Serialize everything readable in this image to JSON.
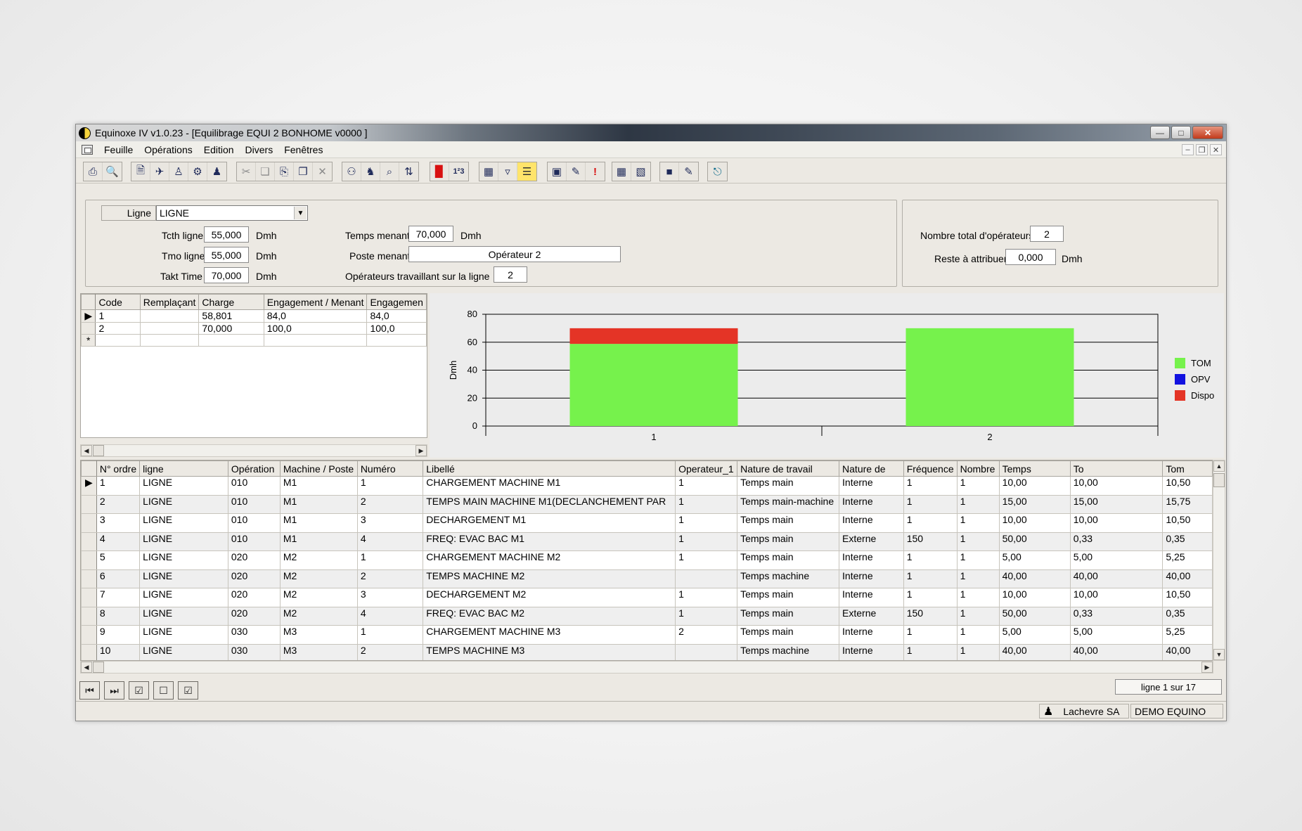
{
  "window": {
    "title": "Equinoxe IV v1.0.23 - [Equilibrage EQUI 2 BONHOME v0000   ]"
  },
  "menu": [
    "Feuille",
    "Opérations",
    "Edition",
    "Divers",
    "Fenêtres"
  ],
  "ligne": {
    "label": "Ligne",
    "value": "LIGNE"
  },
  "params": {
    "tcth_label": "Tcth ligne",
    "tcth": "55,000",
    "tmo_label": "Tmo ligne",
    "tmo": "55,000",
    "takt_label": "Takt Time",
    "takt": "70,000",
    "unit": "Dmh",
    "temps_menant_label": "Temps menant",
    "temps_menant": "70,000",
    "poste_menant_label": "Poste menant",
    "poste_menant": "Opérateur 2",
    "operateurs_ligne_label": "Opérateurs travaillant sur la ligne",
    "operateurs_ligne": "2",
    "nb_total_label": "Nombre total d'opérateurs",
    "nb_total": "2",
    "reste_label": "Reste à attribuer",
    "reste": "0,000"
  },
  "ops_grid": {
    "headers": [
      "Code",
      "Remplaçant",
      "Charge",
      "Engagement / Menant",
      "Engagemen"
    ],
    "rows": [
      [
        "1",
        "",
        "58,801",
        "84,0",
        "84,0"
      ],
      [
        "2",
        "",
        "70,000",
        "100,0",
        "100,0"
      ]
    ],
    "new_row_marker": "*",
    "current_marker": "▶"
  },
  "chart_data": {
    "type": "bar",
    "stacked": true,
    "categories": [
      "1",
      "2"
    ],
    "series": [
      {
        "name": "TOM",
        "color": "#76f24c",
        "values": [
          58.8,
          70
        ]
      },
      {
        "name": "OPV",
        "color": "#1212e0",
        "values": [
          0,
          0
        ]
      },
      {
        "name": "Dispo",
        "color": "#e43426",
        "values": [
          11.2,
          0
        ]
      }
    ],
    "ylabel": "Dmh",
    "ylim": [
      0,
      80
    ],
    "yticks": [
      "0",
      "20",
      "40",
      "60",
      "80"
    ],
    "grid": true,
    "legend": "right"
  },
  "tasks": {
    "headers": [
      "N° ordre",
      "ligne",
      "Opération",
      "Machine / Poste",
      "Numéro",
      "Libellé",
      "Operateur_1",
      "Nature de travail",
      "Nature de",
      "Fréquence",
      "Nombre",
      "Temps",
      "To",
      "Tom"
    ],
    "rows": [
      [
        "1",
        "LIGNE",
        "010",
        "M1",
        "1",
        "CHARGEMENT MACHINE M1",
        "1",
        "Temps main",
        "Interne",
        "1",
        "1",
        "10,00",
        "10,00",
        "10,50"
      ],
      [
        "2",
        "LIGNE",
        "010",
        "M1",
        "2",
        "TEMPS MAIN MACHINE M1(DECLANCHEMENT PAR",
        "1",
        "Temps main-machine",
        "Interne",
        "1",
        "1",
        "15,00",
        "15,00",
        "15,75"
      ],
      [
        "3",
        "LIGNE",
        "010",
        "M1",
        "3",
        "DECHARGEMENT M1",
        "1",
        "Temps main",
        "Interne",
        "1",
        "1",
        "10,00",
        "10,00",
        "10,50"
      ],
      [
        "4",
        "LIGNE",
        "010",
        "M1",
        "4",
        "FREQ: EVAC BAC M1",
        "1",
        "Temps main",
        "Externe",
        "150",
        "1",
        "50,00",
        "0,33",
        "0,35"
      ],
      [
        "5",
        "LIGNE",
        "020",
        "M2",
        "1",
        "CHARGEMENT MACHINE M2",
        "1",
        "Temps main",
        "Interne",
        "1",
        "1",
        "5,00",
        "5,00",
        "5,25"
      ],
      [
        "6",
        "LIGNE",
        "020",
        "M2",
        "2",
        "TEMPS MACHINE M2",
        "",
        "Temps machine",
        "Interne",
        "1",
        "1",
        "40,00",
        "40,00",
        "40,00"
      ],
      [
        "7",
        "LIGNE",
        "020",
        "M2",
        "3",
        "DECHARGEMENT M2",
        "1",
        "Temps main",
        "Interne",
        "1",
        "1",
        "10,00",
        "10,00",
        "10,50"
      ],
      [
        "8",
        "LIGNE",
        "020",
        "M2",
        "4",
        "FREQ: EVAC BAC  M2",
        "1",
        "Temps main",
        "Externe",
        "150",
        "1",
        "50,00",
        "0,33",
        "0,35"
      ],
      [
        "9",
        "LIGNE",
        "030",
        "M3",
        "1",
        "CHARGEMENT MACHINE M3",
        "2",
        "Temps main",
        "Interne",
        "1",
        "1",
        "5,00",
        "5,00",
        "5,25"
      ],
      [
        "10",
        "LIGNE",
        "030",
        "M3",
        "2",
        "TEMPS MACHINE M3",
        "",
        "Temps machine",
        "Interne",
        "1",
        "1",
        "40,00",
        "40,00",
        "40,00"
      ]
    ]
  },
  "footer": {
    "counter": "ligne 1 sur 17"
  },
  "status": {
    "company": "Lachevre SA",
    "user": "DEMO EQUINO"
  },
  "icons": [
    "printer-icon",
    "print-preview-icon",
    "new-sheet-icon",
    "open-icon",
    "person-icon",
    "gears-icon",
    "people-icon",
    "cut-icon",
    "copy-icon",
    "paste-icon",
    "duplicate-icon",
    "delete-icon",
    "search-person-icon",
    "walk-icon",
    "zoom-icon",
    "sort-icon",
    "bar-chart-icon",
    "numbering-icon",
    "network-icon",
    "filter-icon",
    "note-icon",
    "monitor-icon",
    "pencil-icon",
    "alert-icon",
    "table-icon",
    "table-edit-icon",
    "save-icon",
    "export-icon",
    "exit-icon"
  ]
}
